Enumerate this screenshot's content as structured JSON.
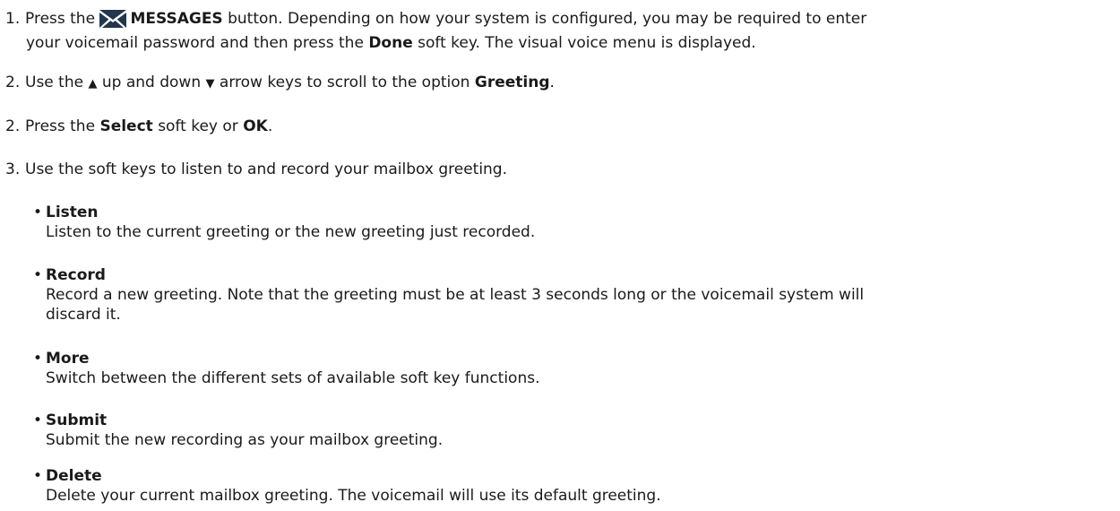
{
  "step1": {
    "number": "1.",
    "text_before_icon": "Press the",
    "icon": "envelope-messages-icon",
    "button_label": "MESSAGES",
    "text_after_button": "button. Depending on how your system is configured, you may be required to enter",
    "line2_before": "your voicemail password and then press the",
    "done_label": "Done",
    "line2_after": "soft key. The visual voice menu is displayed."
  },
  "step2a": {
    "number": "2.",
    "text1": "Use the",
    "up_glyph": "▲",
    "text2": "up and down",
    "down_glyph": "▼",
    "text3": "arrow keys to scroll to the option",
    "option_label": "Greeting",
    "text4": "."
  },
  "step2b": {
    "number": "2.",
    "text1": "Press the",
    "select_label": "Select",
    "text2": "soft key or",
    "ok_label": "OK",
    "text3": "."
  },
  "step3": {
    "number": "3.",
    "text": "Use the soft keys to listen to and record your mailbox greeting."
  },
  "softkeys": [
    {
      "title": "Listen",
      "desc": "Listen to the current greeting or the new greeting just recorded."
    },
    {
      "title": "Record",
      "desc": "Record a new greeting. Note that the greeting must be at least 3 seconds long or the voicemail system will",
      "desc2": "discard it."
    },
    {
      "title": "More",
      "desc": "Switch between the different sets of available soft key functions."
    },
    {
      "title": "Submit",
      "desc": "Submit the new recording as your mailbox greeting."
    },
    {
      "title": "Delete",
      "desc": "Delete your current mailbox greeting. The voicemail will use its default greeting."
    }
  ]
}
